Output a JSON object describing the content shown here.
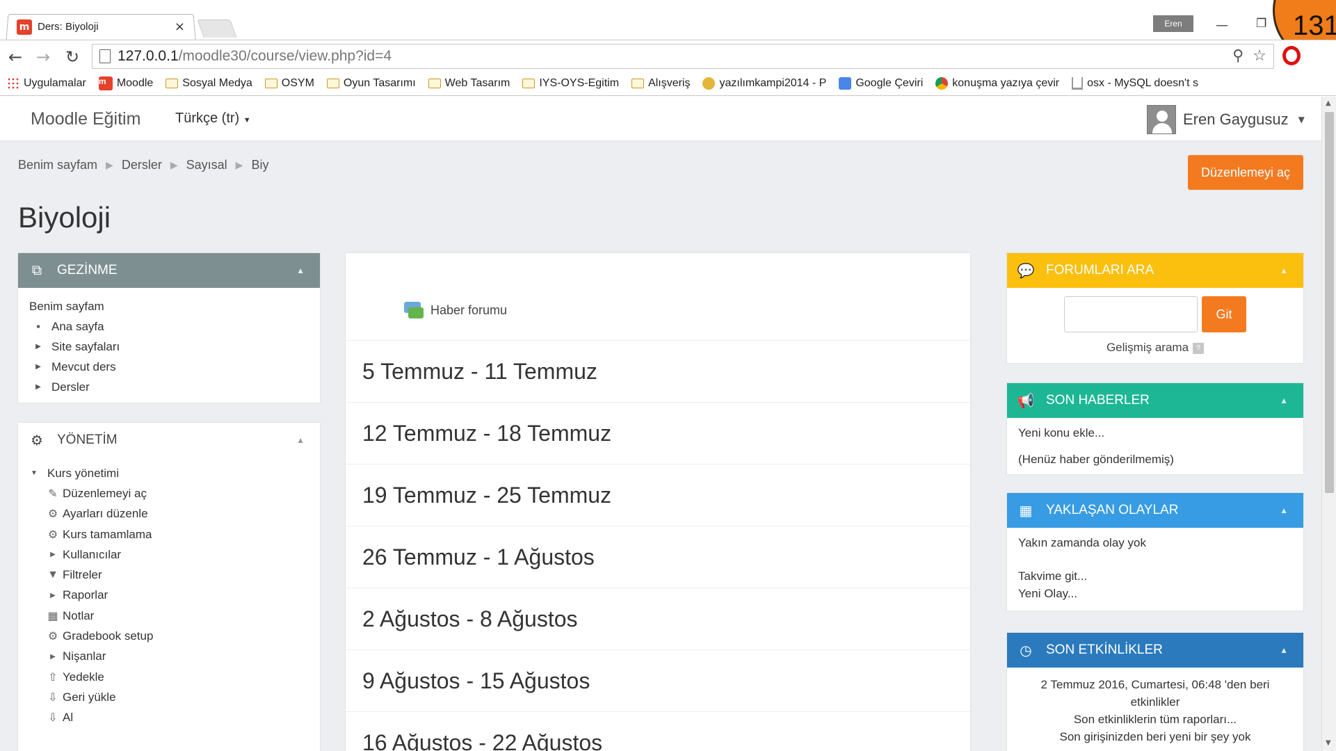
{
  "browser": {
    "tab_title": "Ders: Biyoloji",
    "tab_close": "×",
    "profile_chip": "Eren",
    "badge": "131",
    "url_host": "127.0.0.1",
    "url_path": "/moodle30/course/view.php?id=4",
    "bookmarks": [
      {
        "label": "Uygulamalar",
        "icon": "apps-icon"
      },
      {
        "label": "Moodle",
        "icon": "moodle-icon"
      },
      {
        "label": "Sosyal Medya",
        "icon": "folder-icon"
      },
      {
        "label": "OSYM",
        "icon": "folder-icon"
      },
      {
        "label": "Oyun Tasarımı",
        "icon": "folder-icon"
      },
      {
        "label": "Web Tasarım",
        "icon": "folder-icon"
      },
      {
        "label": "IYS-OYS-Egitim",
        "icon": "folder-icon"
      },
      {
        "label": "Alışveriş",
        "icon": "folder-icon"
      },
      {
        "label": "yazılımkampi2014 - P",
        "icon": "cheetah-icon"
      },
      {
        "label": "Google Çeviri",
        "icon": "translate-icon"
      },
      {
        "label": "konuşma yazıya çevir",
        "icon": "chrome-icon"
      },
      {
        "label": "osx - MySQL doesn't s",
        "icon": "stackoverflow-icon"
      }
    ]
  },
  "navbar": {
    "brand": "Moodle Eğitim",
    "language": "Türkçe (tr)",
    "user_name": "Eren Gaygusuz"
  },
  "breadcrumb": [
    "Benim sayfam",
    "Dersler",
    "Sayısal",
    "Biy"
  ],
  "edit_button": "Düzenlemeyi aç",
  "page_title": "Biyoloji",
  "navigation_block": {
    "title": "GEZİNME",
    "top": "Benim sayfam",
    "items": [
      {
        "label": "Ana sayfa",
        "marker": "■"
      },
      {
        "label": "Site sayfaları",
        "marker": "▶"
      },
      {
        "label": "Mevcut ders",
        "marker": "▶"
      },
      {
        "label": "Dersler",
        "marker": "▶"
      }
    ]
  },
  "admin_block": {
    "title": "YÖNETİM",
    "root": "Kurs yönetimi",
    "items": [
      {
        "label": "Düzenlemeyi aç",
        "icon": "pencil-icon",
        "glyph": "✎"
      },
      {
        "label": "Ayarları düzenle",
        "icon": "gear-icon",
        "glyph": "⚙"
      },
      {
        "label": "Kurs tamamlama",
        "icon": "gear-icon",
        "glyph": "⚙"
      },
      {
        "label": "Kullanıcılar",
        "icon": "expand-arrow-icon",
        "glyph": "▶"
      },
      {
        "label": "Filtreler",
        "icon": "filter-icon",
        "glyph": "▼"
      },
      {
        "label": "Raporlar",
        "icon": "expand-arrow-icon",
        "glyph": "▶"
      },
      {
        "label": "Notlar",
        "icon": "table-icon",
        "glyph": "▦"
      },
      {
        "label": "Gradebook setup",
        "icon": "gear-icon",
        "glyph": "⚙"
      },
      {
        "label": "Nişanlar",
        "icon": "expand-arrow-icon",
        "glyph": "▶"
      },
      {
        "label": "Yedekle",
        "icon": "upload-icon",
        "glyph": "⇧"
      },
      {
        "label": "Geri yükle",
        "icon": "download-icon",
        "glyph": "⇩"
      },
      {
        "label": "Al",
        "icon": "download-icon",
        "glyph": "⇩"
      }
    ]
  },
  "main": {
    "news_forum": "Haber forumu",
    "weeks": [
      "5 Temmuz - 11 Temmuz",
      "12 Temmuz - 18 Temmuz",
      "19 Temmuz - 25 Temmuz",
      "26 Temmuz - 1 Ağustos",
      "2 Ağustos - 8 Ağustos",
      "9 Ağustos - 15 Ağustos",
      "16 Ağustos - 22 Ağustos"
    ]
  },
  "search_block": {
    "title": "FORUMLARI ARA",
    "button": "Git",
    "advanced": "Gelişmiş arama",
    "help": "?"
  },
  "news_block": {
    "title": "SON HABERLER",
    "add": "Yeni konu ekle...",
    "empty": "(Henüz haber gönderilmemiş)"
  },
  "events_block": {
    "title": "YAKLAŞAN OLAYLAR",
    "none": "Yakın zamanda olay yok",
    "calendar": "Takvime git...",
    "new_event": "Yeni Olay..."
  },
  "activity_block": {
    "title": "SON ETKİNLİKLER",
    "since": "2 Temmuz 2016, Cumartesi, 06:48 'den beri etkinlikler",
    "reports": "Son etkinliklerin tüm raporları...",
    "nothing": "Son girişinizden beri yeni bir şey yok"
  },
  "colors": {
    "orange": "#f47a20",
    "nav_header": "#7d8f90",
    "admin_header": "#ffffff",
    "search_header": "#fbbf0e",
    "news_header": "#1db795",
    "events_header": "#379ce3",
    "activity_header": "#2b7abd"
  }
}
